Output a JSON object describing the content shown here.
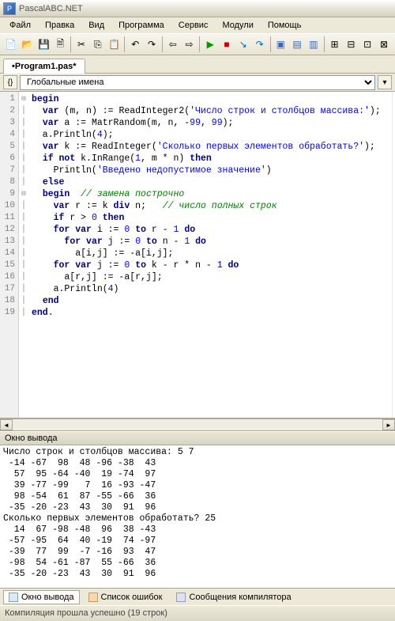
{
  "window": {
    "title": "PascalABC.NET"
  },
  "menu": {
    "file": "Файл",
    "edit": "Правка",
    "view": "Вид",
    "program": "Программа",
    "service": "Сервис",
    "modules": "Модули",
    "help": "Помощь"
  },
  "tab": {
    "label": "•Program1.pas*"
  },
  "scope": {
    "label": "Глобальные имена"
  },
  "code": {
    "lines": [
      "begin",
      "  var (m, n) := ReadInteger2('Число строк и столбцов массива:');",
      "  var a := MatrRandom(m, n, -99, 99);",
      "  a.Println(4);",
      "  var k := ReadInteger('Сколько первых элементов обработать?');",
      "  if not k.InRange(1, m * n) then",
      "    Println('Введено недопустимое значение')",
      "  else",
      "  begin  // замена построчно",
      "    var r := k div n;   // число полных строк",
      "    if r > 0 then",
      "    for var i := 0 to r - 1 do",
      "      for var j := 0 to n - 1 do",
      "        a[i,j] := -a[i,j];",
      "    for var j := 0 to k - r * n - 1 do",
      "      a[r,j] := -a[r,j];",
      "    a.Println(4)",
      "  end",
      "end."
    ]
  },
  "output": {
    "title": "Окно вывода",
    "text": "Число строк и столбцов массива: 5 7\n -14 -67  98  48 -96 -38  43\n  57  95 -64 -40  19 -74  97\n  39 -77 -99   7  16 -93 -47\n  98 -54  61  87 -55 -66  36\n -35 -20 -23  43  30  91  96\nСколько первых элементов обработать? 25\n  14  67 -98 -48  96  38 -43\n -57 -95  64  40 -19  74 -97\n -39  77  99  -7 -16  93  47\n -98  54 -61 -87  55 -66  36\n -35 -20 -23  43  30  91  96"
  },
  "bottomTabs": {
    "output": "Окно вывода",
    "errors": "Список ошибок",
    "compiler": "Сообщения компилятора"
  },
  "status": {
    "text": "Компиляция прошла успешно (19 строк)"
  },
  "icons": {
    "new": "📄",
    "open": "📂",
    "save": "💾",
    "saveall": "🗎",
    "cut": "✂",
    "copy": "⎘",
    "paste": "📋",
    "undo": "↶",
    "redo": "↷",
    "nav1": "⇦",
    "nav2": "⇨",
    "run": "▶",
    "stop": "■",
    "into": "↘",
    "over": "↷",
    "box1": "▣",
    "box2": "▤",
    "box3": "▥",
    "g1": "⊞",
    "g2": "⊟",
    "g3": "⊡",
    "g4": "⊠"
  }
}
